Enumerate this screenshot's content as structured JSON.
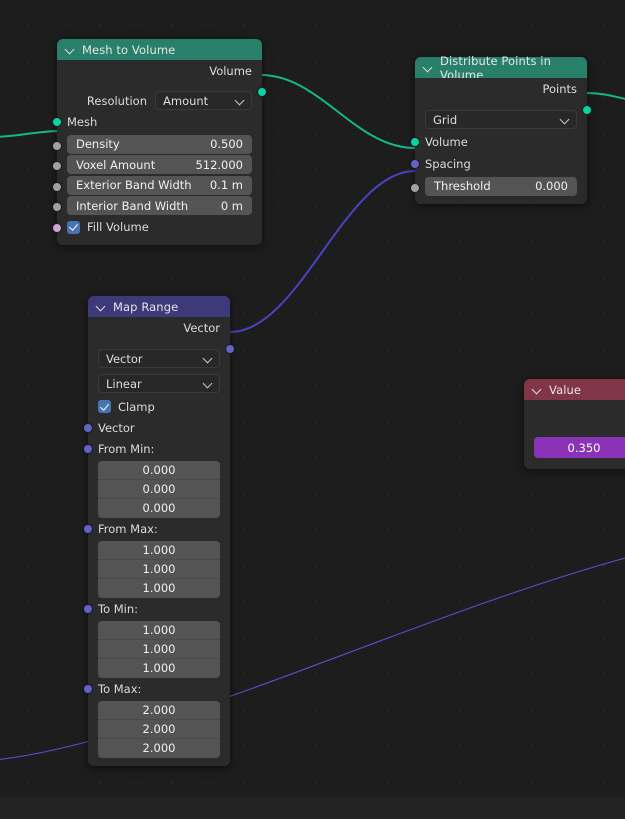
{
  "editor": {
    "name": "blender-geometry-node-editor"
  },
  "nodes": {
    "mesh_to_volume": {
      "title": "Mesh to Volume",
      "outputs": [
        {
          "label": "Volume",
          "socket": "geometry"
        }
      ],
      "resolution": {
        "label": "Resolution",
        "value": "Amount"
      },
      "inputs": [
        {
          "label": "Mesh",
          "socket": "geometry"
        }
      ],
      "fields": [
        {
          "label": "Density",
          "value": "0.500",
          "socket": "float"
        },
        {
          "label": "Voxel Amount",
          "value": "512.000",
          "socket": "float"
        },
        {
          "label": "Exterior Band Width",
          "value": "0.1 m",
          "socket": "float"
        },
        {
          "label": "Interior Band Width",
          "value": "0 m",
          "socket": "float"
        }
      ],
      "fill_volume": {
        "label": "Fill Volume",
        "checked": true,
        "socket": "boolean"
      }
    },
    "distribute_points": {
      "title": "Distribute Points in Volume",
      "outputs": [
        {
          "label": "Points",
          "socket": "geometry"
        }
      ],
      "mode": {
        "value": "Grid"
      },
      "inputs": [
        {
          "label": "Volume",
          "socket": "geometry"
        },
        {
          "label": "Spacing",
          "socket": "vector"
        }
      ],
      "fields": [
        {
          "label": "Threshold",
          "value": "0.000",
          "socket": "float"
        }
      ]
    },
    "map_range": {
      "title": "Map Range",
      "outputs": [
        {
          "label": "Vector",
          "socket": "vector"
        }
      ],
      "data_type": {
        "value": "Vector"
      },
      "interpolation": {
        "value": "Linear"
      },
      "clamp": {
        "label": "Clamp",
        "checked": true
      },
      "vector_input": {
        "label": "Vector",
        "socket": "vector"
      },
      "groups": [
        {
          "label": "From Min:",
          "socket": "vector",
          "values": [
            "0.000",
            "0.000",
            "0.000"
          ]
        },
        {
          "label": "From Max:",
          "socket": "vector",
          "values": [
            "1.000",
            "1.000",
            "1.000"
          ]
        },
        {
          "label": "To Min:",
          "socket": "vector",
          "values": [
            "1.000",
            "1.000",
            "1.000"
          ]
        },
        {
          "label": "To Max:",
          "socket": "vector",
          "values": [
            "2.000",
            "2.000",
            "2.000"
          ]
        }
      ]
    },
    "value": {
      "title": "Value",
      "slider": {
        "value": "0.350"
      }
    }
  },
  "colors": {
    "header_green": "#28806a",
    "header_purple": "#3e3a79",
    "header_red": "#803647",
    "socket_geometry": "#00d6a3",
    "socket_vector": "#6363c7",
    "socket_float": "#a1a1a1",
    "socket_boolean": "#cca6d6",
    "noodle_geometry": "#14b88a",
    "noodle_vector": "#4a43c4",
    "slider_fill": "#8a32b8",
    "background": "#1d1d1d"
  }
}
